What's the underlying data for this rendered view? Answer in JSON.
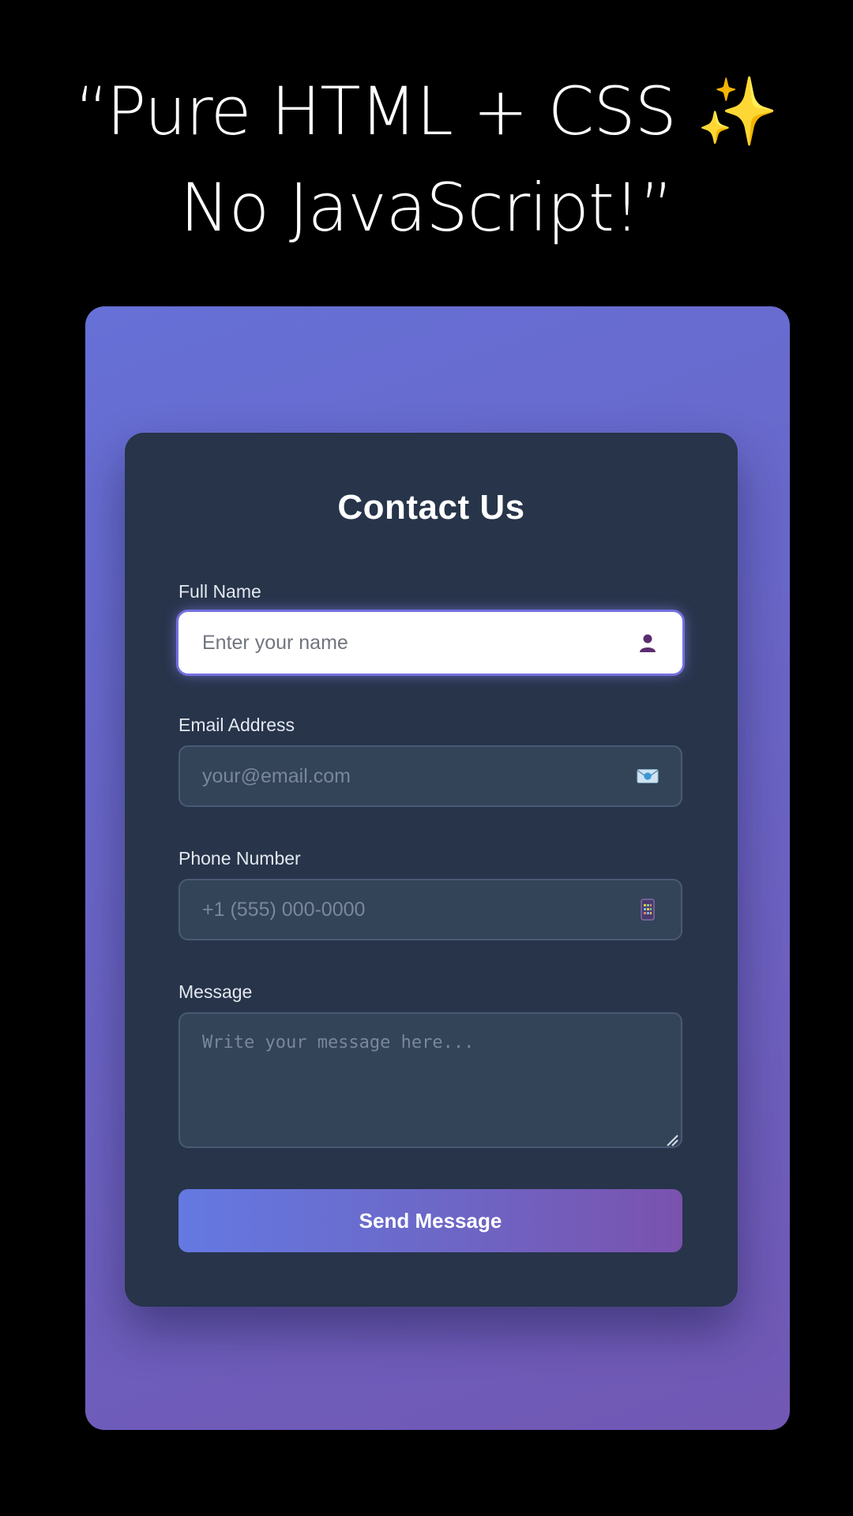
{
  "caption": {
    "line1": "“Pure HTML + CSS",
    "sparkle": "✨",
    "line2": "No JavaScript!”"
  },
  "form": {
    "title": "Contact Us",
    "fields": [
      {
        "label": "Full Name",
        "placeholder": "Enter your name",
        "icon": "person-icon"
      },
      {
        "label": "Email Address",
        "placeholder": "your@email.com",
        "icon": "email-icon"
      },
      {
        "label": "Phone Number",
        "placeholder": "+1 (555) 000-0000",
        "icon": "phone-icon"
      },
      {
        "label": "Message",
        "placeholder": "Write your message here...",
        "icon": "resize-grip-icon"
      }
    ],
    "submit_label": "Send Message"
  },
  "colors": {
    "page_background": "#000000",
    "stage_gradient_start": "#6670d6",
    "stage_gradient_end": "#7158b4",
    "card_background": "#27344a",
    "input_background": "#334358",
    "focus_glow": "#7873eb",
    "button_gradient_start": "#6479e2",
    "button_gradient_end": "#7a52ae"
  }
}
